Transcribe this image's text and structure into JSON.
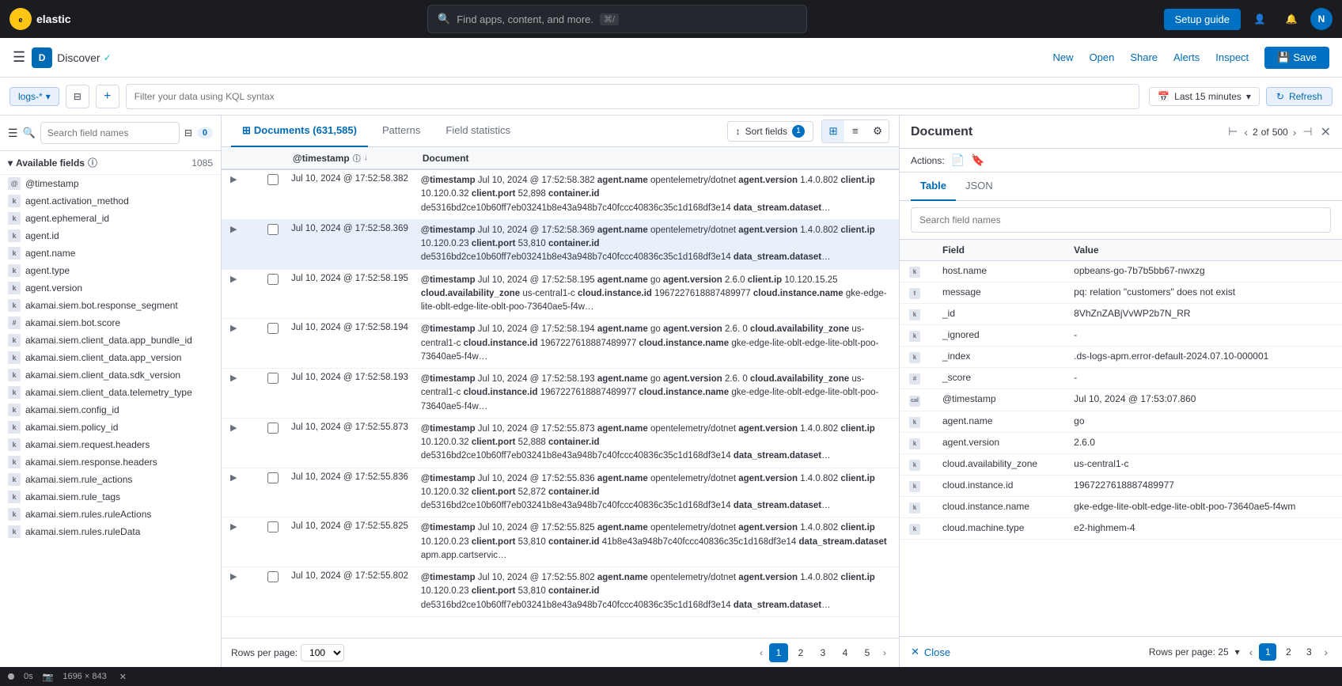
{
  "app": {
    "name": "Discover",
    "badge_letter": "D",
    "check": "✓"
  },
  "topnav": {
    "search_placeholder": "Find apps, content, and more.",
    "kbd_shortcut": "⌘/",
    "setup_guide_label": "Setup guide",
    "new_label": "New",
    "open_label": "Open",
    "share_label": "Share",
    "alerts_label": "Alerts",
    "inspect_label": "Inspect",
    "save_label": "Save"
  },
  "toolbar": {
    "index_pattern": "logs-*",
    "kql_placeholder": "Filter your data using KQL syntax",
    "time_label": "Last 15 minutes",
    "refresh_label": "Refresh"
  },
  "sidebar": {
    "search_placeholder": "Search field names",
    "filter_count": "0",
    "section_title": "Available fields",
    "section_info": "ⓘ",
    "section_count": "1085",
    "fields": [
      {
        "type": "@",
        "name": "@timestamp"
      },
      {
        "type": "k",
        "name": "agent.activation_method"
      },
      {
        "type": "k",
        "name": "agent.ephemeral_id"
      },
      {
        "type": "k",
        "name": "agent.id"
      },
      {
        "type": "k",
        "name": "agent.name"
      },
      {
        "type": "k",
        "name": "agent.type"
      },
      {
        "type": "k",
        "name": "agent.version"
      },
      {
        "type": "k",
        "name": "akamai.siem.bot.response_segment"
      },
      {
        "type": "#",
        "name": "akamai.siem.bot.score"
      },
      {
        "type": "k",
        "name": "akamai.siem.client_data.app_bundle_id"
      },
      {
        "type": "k",
        "name": "akamai.siem.client_data.app_version"
      },
      {
        "type": "k",
        "name": "akamai.siem.client_data.sdk_version"
      },
      {
        "type": "k",
        "name": "akamai.siem.client_data.telemetry_type"
      },
      {
        "type": "k",
        "name": "akamai.siem.config_id"
      },
      {
        "type": "k",
        "name": "akamai.siem.policy_id"
      },
      {
        "type": "k",
        "name": "akamai.siem.request.headers"
      },
      {
        "type": "k",
        "name": "akamai.siem.response.headers"
      },
      {
        "type": "k",
        "name": "akamai.siem.rule_actions"
      },
      {
        "type": "k",
        "name": "akamai.siem.rule_tags"
      },
      {
        "type": "k",
        "name": "akamai.siem.rules.ruleActions"
      },
      {
        "type": "k",
        "name": "akamai.siem.rules.ruleData"
      }
    ]
  },
  "tabs": {
    "documents": "Documents (631,585)",
    "patterns": "Patterns",
    "field_statistics": "Field statistics"
  },
  "sort_fields": "Sort fields",
  "sort_badge": "1",
  "table": {
    "col_timestamp": "@timestamp",
    "col_document": "Document",
    "rows": [
      {
        "time": "Jul 10, 2024 @ 17:52:58.382",
        "doc": "@timestamp Jul 10, 2024 @ 17:52:58.382 agent.name opentelemetry/dotnet agent.version 1.4.0.802 client.ip 10.120.0.32 client.port 52,898 container.id de5316bd2ce10b60ff7eb03241b8e43a948b7c40fccc40836c35c1d168df3e14 data_stream.dataset apm.app.cartservic…",
        "selected": false
      },
      {
        "time": "Jul 10, 2024 @ 17:52:58.369",
        "doc": "@timestamp Jul 10, 2024 @ 17:52:58.369 agent.name opentelemetry/dotnet agent.version 1.4.0.802 client.ip 10.120.0.23 client.port 53,810 container.id de5316bd2ce10b60ff7eb03241b8e43a948b7c40fccc40836c35c1d168df3e14 data_stream.dataset apm.app.cartservic…",
        "selected": true
      },
      {
        "time": "Jul 10, 2024 @ 17:52:58.195",
        "doc": "@timestamp Jul 10, 2024 @ 17:52:58.195 agent.name go agent.version 2.6.0 client.ip 10.120.15.25 cloud.availability_zone us-central1-c cloud.instance.id 1967227618887489977 cloud.instance.name gke-edge-lite-oblt-edge-lite-oblt-poo-73640ae5-f4w…",
        "selected": false
      },
      {
        "time": "Jul 10, 2024 @ 17:52:58.194",
        "doc": "@timestamp Jul 10, 2024 @ 17:52:58.194 agent.name go agent.version 2.6.0 cloud.availability_zone us-central1-c cloud.instance.id 1967227618887489977 cloud.instance.name gke-edge-lite-oblt-edge-lite-oblt-poo-73640ae5-f4w…",
        "selected": false
      },
      {
        "time": "Jul 10, 2024 @ 17:52:58.193",
        "doc": "@timestamp Jul 10, 2024 @ 17:52:58.193 agent.name go agent.version 2.6.0 cloud.availability_zone us-central1-c cloud.instance.id 1967227618887489977 cloud.instance.name gke-edge-lite-oblt-edge-lite-oblt-poo-73640ae5-f4w…",
        "selected": false
      },
      {
        "time": "Jul 10, 2024 @ 17:52:55.873",
        "doc": "@timestamp Jul 10, 2024 @ 17:52:55.873 agent.name opentelemetry/dotnet agent.version 1.4.0.802 client.ip 10.120.0.32 client.port 52,888 container.id de5316bd2ce10b60ff7eb03241b8e43a948b7c40fccc40836c35c1d168df3e14 data_stream.dataset apm.app.cartservic…",
        "selected": false
      },
      {
        "time": "Jul 10, 2024 @ 17:52:55.836",
        "doc": "@timestamp Jul 10, 2024 @ 17:52:55.836 agent.name opentelemetry/dotnet agent.version 1.4.0.802 client.ip 10.120.0.32 client.port 52,872 container.id de5316bd2ce10b60ff7eb03241b8e43a948b7c40fccc40836c35c1d168df3e14 data_stream.dataset apm.app.cartservic…",
        "selected": false
      },
      {
        "time": "Jul 10, 2024 @ 17:52:55.825",
        "doc": "@timestamp Jul 10, 2024 @ 17:52:55.825 agent.name opentelemetry/dotnet agent.version 1.4.0.802 client.ip 10.120.0.23 client.port 53,810 container.id 41b8e43a948b7c40fccc40836c35c1d168df3e14 data_stream.dataset apm.app.cartservic…",
        "selected": false
      },
      {
        "time": "Jul 10, 2024 @ 17:52:55.802",
        "doc": "@timestamp Jul 10, 2024 @ 17:52:55.802 agent.name opentelemetry/dotnet agent.version 1.4.0.802 client.ip 10.120.0.23 client.port 53,810 container.id de5316bd2ce10b60ff7eb03241b8e43a948b7c40fccc40836c35c1d168df3e14 data_stream.dataset apm.app.cartservic…",
        "selected": false
      }
    ]
  },
  "pagination": {
    "rows_per_page_label": "Rows per page:",
    "rows_per_page_value": "100",
    "pages": [
      "1",
      "2",
      "3",
      "4",
      "5"
    ]
  },
  "doc_panel": {
    "title": "Document",
    "current_doc": "2",
    "total_docs": "500",
    "actions_label": "Actions:",
    "tab_table": "Table",
    "tab_json": "JSON",
    "search_placeholder": "Search field names",
    "cols": {
      "field": "Field",
      "value": "Value"
    },
    "fields": [
      {
        "type": "k",
        "name": "host.name",
        "value": "opbeans-go-7b7b5bb67-nwxzg"
      },
      {
        "type": "t",
        "name": "message",
        "value": "pq: relation \"customers\" does not exist"
      },
      {
        "type": "k",
        "name": "_id",
        "value": "8VhZnZABjVvWP2b7N_RR"
      },
      {
        "type": "k",
        "name": "_ignored",
        "value": "-"
      },
      {
        "type": "k",
        "name": "_index",
        "value": ".ds-logs-apm.error-default-2024.07.10-000001"
      },
      {
        "type": "#",
        "name": "_score",
        "value": "-"
      },
      {
        "type": "cal",
        "name": "@timestamp",
        "value": "Jul 10, 2024 @ 17:53:07.860"
      },
      {
        "type": "k",
        "name": "agent.name",
        "value": "go"
      },
      {
        "type": "k",
        "name": "agent.version",
        "value": "2.6.0"
      },
      {
        "type": "k",
        "name": "cloud.availability_zone",
        "value": "us-central1-c"
      },
      {
        "type": "k",
        "name": "cloud.instance.id",
        "value": "1967227618887489977"
      },
      {
        "type": "k",
        "name": "cloud.instance.name",
        "value": "gke-edge-lite-oblt-edge-lite-oblt-poo-73640ae5-f4wm"
      },
      {
        "type": "k",
        "name": "cloud.machine.type",
        "value": "e2-highmem-4"
      }
    ],
    "footer": {
      "close_label": "Close",
      "rows_per_page_label": "Rows per page: 25",
      "pages": [
        "1",
        "2",
        "3"
      ]
    }
  },
  "status_bar": {
    "time": "0s",
    "dimensions": "1696 × 843"
  }
}
